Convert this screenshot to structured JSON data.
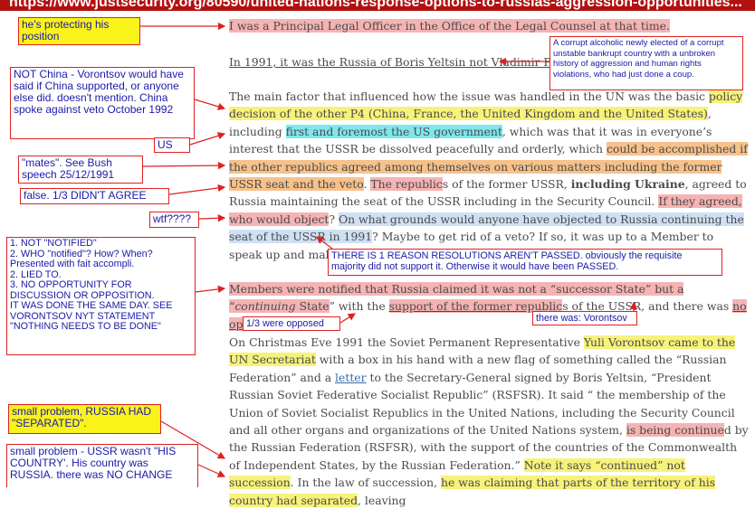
{
  "header": {
    "url_text": "https://www.justsecurity.org/80590/united-nations-response-options-to-russias-aggression-opportunities..."
  },
  "article": {
    "p1": "I was a Principal Legal Officer in the Office of the Legal Counsel at that time.",
    "p2": "In 1991, it was the Russia of Boris Yeltsin not Vladimir Putin.",
    "p3": {
      "a": "The main factor that influenced how the issue was handled in the UN was the basic ",
      "b": "policy decision of the other P4 (China, France, the United Kingdom and the United States)",
      "c": ", including ",
      "d": "first and foremost the US government",
      "e": ", which was that it was in everyone’s interest that the USSR be dissolved peacefully and orderly, which ",
      "f": "could be accomplished if the other republics agreed among themselves on various matters including the former USSR seat and the veto",
      "g": ". ",
      "h": "The republic",
      "i": "s of the former USSR, ",
      "j": "including Ukraine",
      "k": ", agreed to Russia maintaining the seat of the USSR including in the Security Council. ",
      "l": "If they agreed, who would object",
      "m": "? ",
      "n": "On what grounds would anyone have objected to Russia continuing the seat of the USSR in 1991",
      "o": "? Maybe to get rid of a veto? If so, it was up to a Member to speak up and make the case."
    },
    "p4": {
      "a": "Members were notified that Russia claimed it was not a “successor State” but a “",
      "b": "continuing",
      "c": " State",
      "d": "” with the ",
      "e": "support of the former republic",
      "f": "s of the USSR, and there was ",
      "g": "no opposition",
      "h": "."
    },
    "p5": {
      "a": "On Christmas Eve 1991 the Soviet Permanent Representative ",
      "b": "Yuli Vorontsov came to the UN Secretariat",
      "c": " with a box in his hand with a new flag of something called the “Russian Federation” and a ",
      "d": "letter",
      "e": " to the Secretary-General signed by Boris Yeltsin, “President Russian Soviet Federative Socialist Republic” (RSFSR). It said “ the membership of the Union of Soviet Socialist Republics in the United Nations, including the Security Council and all other organs and organizations of the United Nations system, ",
      "f": "is being continue",
      "g": "d by the Russian Federation (RSFSR), with the support of the countries of the Commonwealth of Independent States, by the Russian Federation.” ",
      "h": "Note it says “continued” not succession",
      "i": ". In the law of succession, ",
      "j": "he was claiming that parts of the territory of his country had separated",
      "k": ", leaving"
    }
  },
  "annotations": {
    "protecting": "he's protecting his position",
    "corrupt": "A corrupt alcoholic newly elected of a corrupt unstable bankrupt country with a unbroken history of aggression and human rights violations, who had just done a coup.",
    "not_china": "NOT China - Vorontsov would have said if China supported, or anyone else did. doesn't mention. China spoke against veto October 1992",
    "us": "US",
    "mates": "\"mates\". See Bush speech 25/12/1991",
    "false": "false. 1/3 DIDN'T AGREE",
    "wtf": "wtf????",
    "notified_list": "1. NOT \"NOTIFIED\"\n2. WHO \"notified\"? How? When? Presented with fait accompli.\n2. LIED TO.\n3. NO OPPORTUNITY FOR DISCUSSION OR OPPOSITION.\nIT WAS DONE THE SAME DAY. SEE VORONTSOV NYT STATEMENT \"NOTHING NEEDS TO BE DONE\"",
    "resolutions": "THERE IS 1 REASON RESOLUTIONS AREN'T PASSED. obviously the requisite majority did not support it. Otherwise it would have been PASSED.",
    "third_opposed": "1/3 were opposed",
    "there_was": "there was: Vorontsov",
    "separated": "small problem, RUSSIA HAD \"SEPARATED\".",
    "his_country": "small problem - USSR wasn't \"HIS COUNTRY'. His country was RUSSIA.  there was NO CHANGE"
  },
  "colors": {
    "highlight_yellow": "#f7f27a",
    "highlight_pink": "#f5b3b3",
    "highlight_orange": "#f6c18a",
    "highlight_cyan": "#7ee7ee",
    "annotation_border": "#e02020",
    "annotation_text": "#1a1aa8",
    "header_red": "#b31010"
  }
}
